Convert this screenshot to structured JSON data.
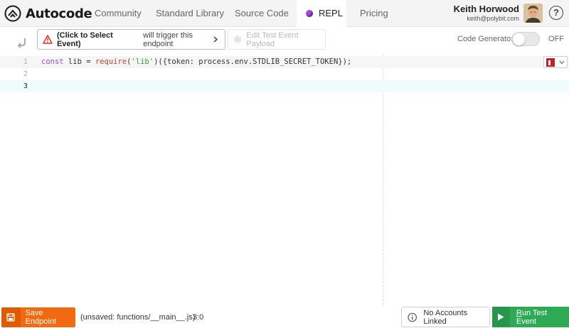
{
  "app": {
    "logo_text": "Autocode"
  },
  "nav": {
    "items": [
      {
        "label": "Community"
      },
      {
        "label": "Standard Library"
      },
      {
        "label": "Source Code"
      },
      {
        "label": "REPL"
      },
      {
        "label": "Pricing"
      }
    ],
    "active_index": 3
  },
  "user": {
    "name": "Keith Horwood",
    "email": "keith@polybit.com"
  },
  "help": {
    "label": "?"
  },
  "toolbar": {
    "event_title": "(Click to Select Event)",
    "event_subtitle": "will trigger this endpoint",
    "edit_payload_label": "Edit Test Event Payload",
    "code_generator_label": "Code Generator",
    "code_generator_state": "OFF"
  },
  "editor": {
    "line_numbers": [
      "1",
      "2",
      "3"
    ],
    "current_line": 3,
    "code_tokens": {
      "kw": "const",
      "ident": " lib = ",
      "fn": "require",
      "paren_open": "(",
      "str": "'lib'",
      "rest": ")({token: process.env.STDLIB_SECRET_TOKEN});"
    }
  },
  "footer": {
    "save_label": "Save Endpoint",
    "file_path": "(unsaved: functions/__main__.js)",
    "cursor_pos": "3:0",
    "accounts_label": "No Accounts Linked",
    "run_label": "Run Test Event"
  },
  "colors": {
    "accent_orange": "#f26a0f",
    "run_green": "#2faa54",
    "keyword_purple": "#9b4fc7",
    "string_green": "#3f9a3a",
    "warning_red": "#d9302c"
  }
}
